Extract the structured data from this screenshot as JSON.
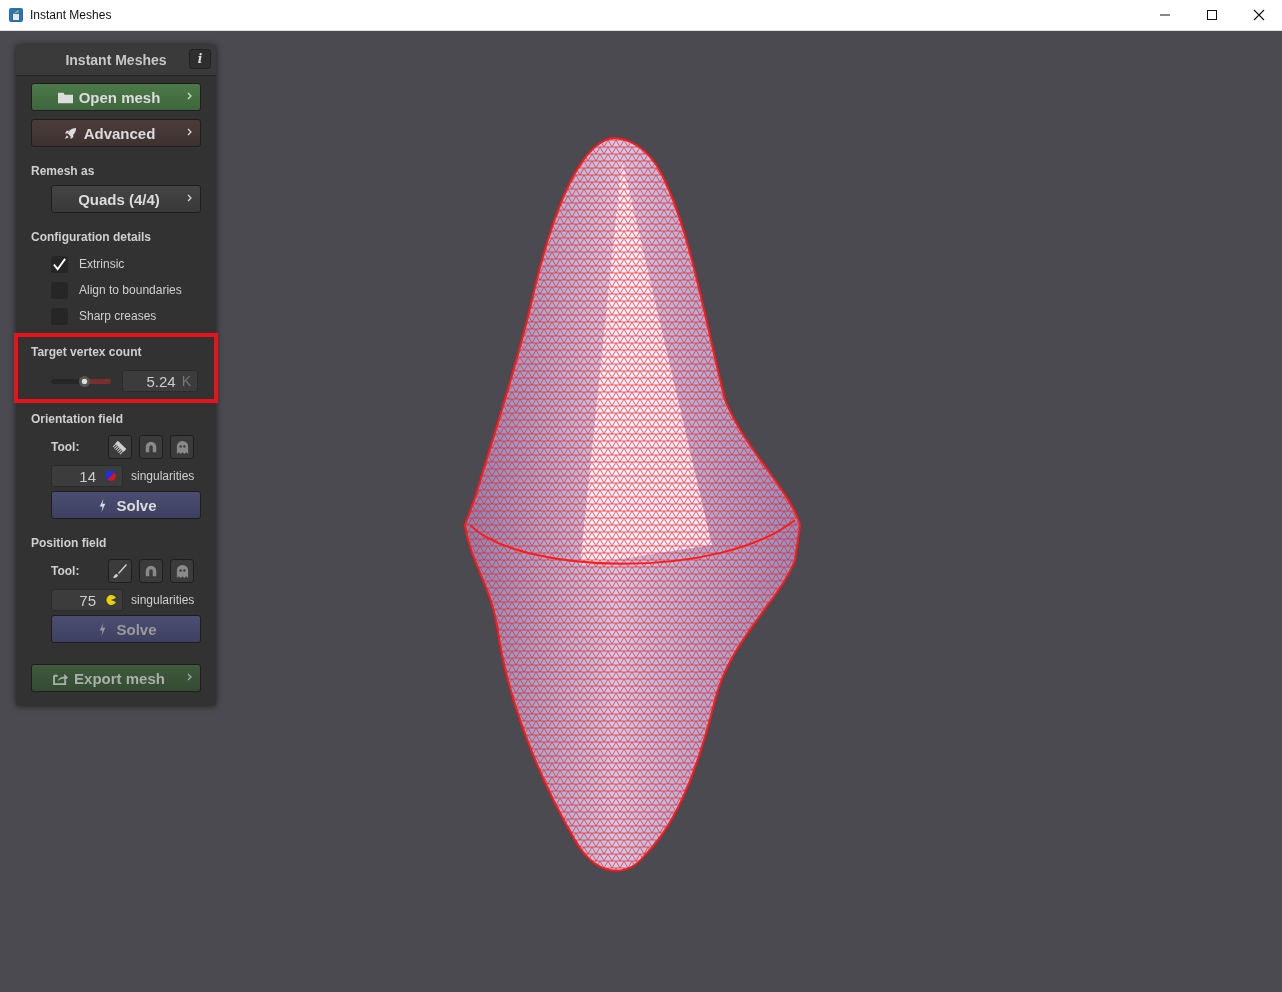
{
  "window": {
    "title": "Instant Meshes"
  },
  "panel": {
    "title": "Instant Meshes",
    "info_label": "i",
    "open_button": {
      "label": "Open mesh",
      "disabled": false
    },
    "advanced_button": {
      "label": "Advanced",
      "disabled": false
    },
    "remesh": {
      "label": "Remesh as",
      "value": "Quads (4/4)"
    },
    "config": {
      "label": "Configuration details",
      "options": [
        {
          "label": "Extrinsic",
          "checked": true
        },
        {
          "label": "Align to boundaries",
          "checked": false
        },
        {
          "label": "Sharp creases",
          "checked": false
        }
      ]
    },
    "target": {
      "label": "Target vertex count",
      "level": 0.55,
      "value": "5.24",
      "unit": "K",
      "highlighted": true
    },
    "fields": [
      {
        "kind": "orientation",
        "label": "Orientation field",
        "tool_label": "Tool:",
        "tools": [
          {
            "kind": "comb",
            "disabled": false
          },
          {
            "kind": "magnet",
            "disabled": true
          },
          {
            "kind": "ghost",
            "disabled": true
          }
        ],
        "count": "14",
        "count_label": "singularities",
        "solve": {
          "label": "Solve",
          "disabled": false
        }
      },
      {
        "kind": "position",
        "label": "Position field",
        "tool_label": "Tool:",
        "tools": [
          {
            "kind": "brush",
            "disabled": false
          },
          {
            "kind": "magnet",
            "disabled": true
          },
          {
            "kind": "ghost",
            "disabled": true
          }
        ],
        "count": "75",
        "count_label": "singularities",
        "solve": {
          "label": "Solve",
          "disabled": true
        }
      }
    ],
    "export_button": {
      "label": "Export mesh",
      "disabled": true
    }
  }
}
